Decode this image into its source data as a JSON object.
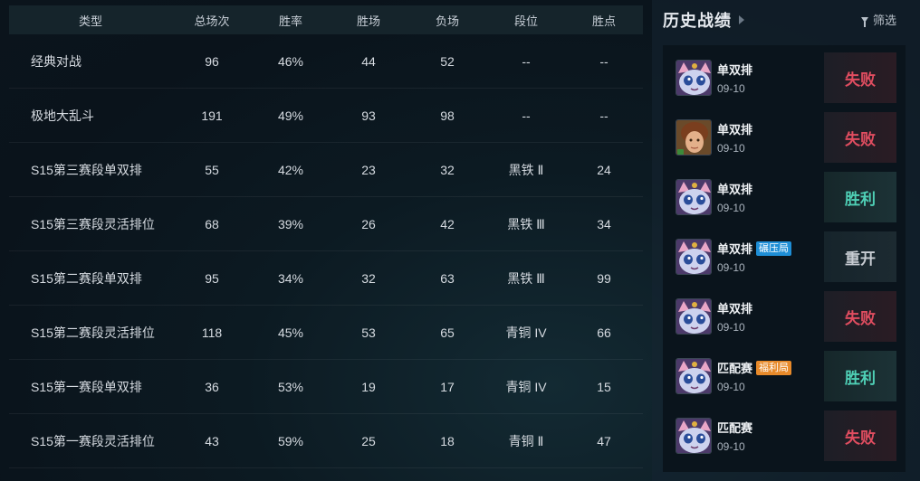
{
  "stats_table": {
    "headers": [
      "类型",
      "总场次",
      "胜率",
      "胜场",
      "负场",
      "段位",
      "胜点"
    ],
    "rows": [
      {
        "type": "经典对战",
        "total": "96",
        "winrate": "46%",
        "wins": "44",
        "losses": "52",
        "rank": "--",
        "lp": "--"
      },
      {
        "type": "极地大乱斗",
        "total": "191",
        "winrate": "49%",
        "wins": "93",
        "losses": "98",
        "rank": "--",
        "lp": "--"
      },
      {
        "type": "S15第三赛段单双排",
        "total": "55",
        "winrate": "42%",
        "wins": "23",
        "losses": "32",
        "rank": "黑铁 Ⅱ",
        "lp": "24"
      },
      {
        "type": "S15第三赛段灵活排位",
        "total": "68",
        "winrate": "39%",
        "wins": "26",
        "losses": "42",
        "rank": "黑铁 Ⅲ",
        "lp": "34"
      },
      {
        "type": "S15第二赛段单双排",
        "total": "95",
        "winrate": "34%",
        "wins": "32",
        "losses": "63",
        "rank": "黑铁 Ⅲ",
        "lp": "99"
      },
      {
        "type": "S15第二赛段灵活排位",
        "total": "118",
        "winrate": "45%",
        "wins": "53",
        "losses": "65",
        "rank": "青铜 IV",
        "lp": "66"
      },
      {
        "type": "S15第一赛段单双排",
        "total": "36",
        "winrate": "53%",
        "wins": "19",
        "losses": "17",
        "rank": "青铜 IV",
        "lp": "15"
      },
      {
        "type": "S15第一赛段灵活排位",
        "total": "43",
        "winrate": "59%",
        "wins": "25",
        "losses": "18",
        "rank": "青铜 Ⅱ",
        "lp": "47"
      }
    ]
  },
  "history": {
    "title": "历史战绩",
    "filter_label": "筛选",
    "matches": [
      {
        "mode": "单双排",
        "tag": "",
        "date": "09-10",
        "result": "失败",
        "result_type": "lose",
        "avatar": "yuumi-cat-icon"
      },
      {
        "mode": "单双排",
        "tag": "",
        "date": "09-10",
        "result": "失败",
        "result_type": "lose",
        "avatar": "champion-portrait-icon"
      },
      {
        "mode": "单双排",
        "tag": "",
        "date": "09-10",
        "result": "胜利",
        "result_type": "win",
        "avatar": "yuumi-cat-icon"
      },
      {
        "mode": "单双排",
        "tag": "碾压局",
        "date": "09-10",
        "result": "重开",
        "result_type": "redo",
        "avatar": "yuumi-cat-icon"
      },
      {
        "mode": "单双排",
        "tag": "",
        "date": "09-10",
        "result": "失败",
        "result_type": "lose",
        "avatar": "yuumi-cat-icon"
      },
      {
        "mode": "匹配赛",
        "tag": "福利局",
        "date": "09-10",
        "result": "胜利",
        "result_type": "win",
        "avatar": "yuumi-cat-icon"
      },
      {
        "mode": "匹配赛",
        "tag": "",
        "date": "09-10",
        "result": "失败",
        "result_type": "lose",
        "avatar": "yuumi-cat-icon"
      }
    ],
    "tag_colors": {
      "碾压局": "#1e8ed6",
      "福利局": "#e88a2a"
    }
  }
}
